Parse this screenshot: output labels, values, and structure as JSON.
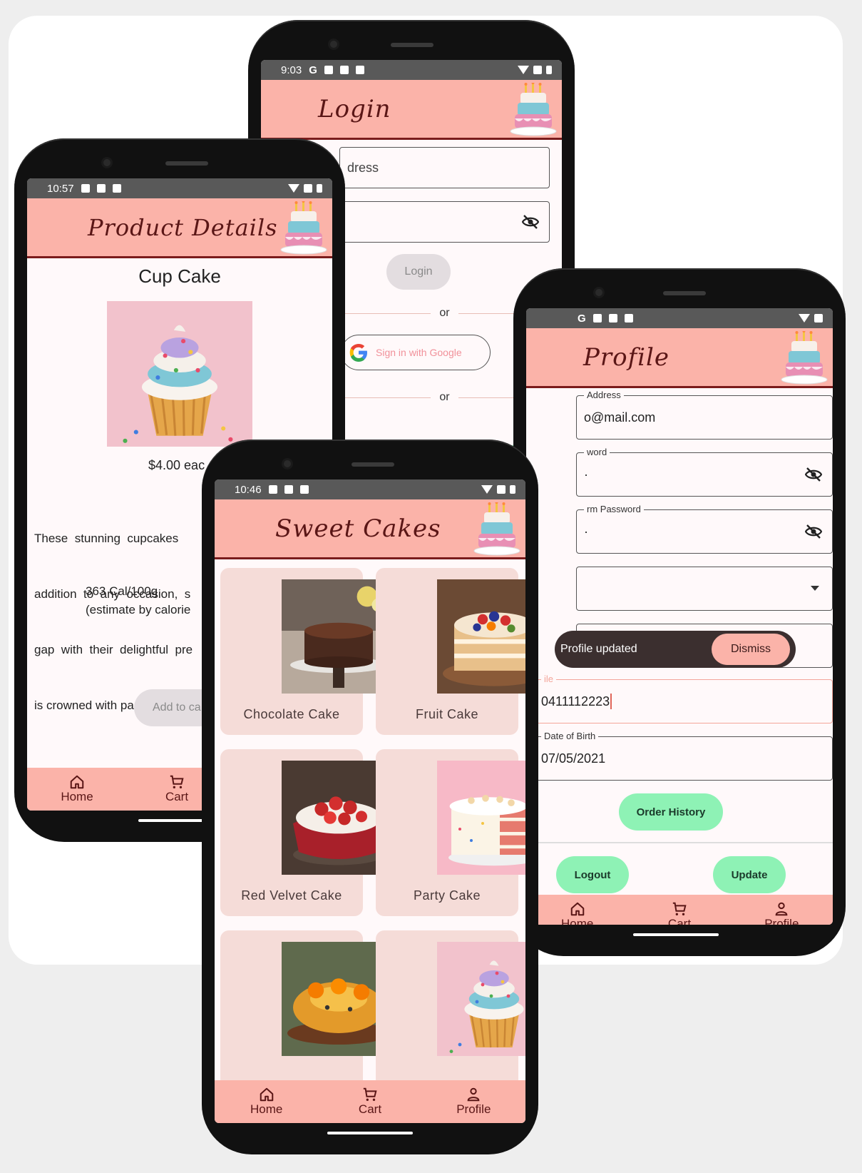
{
  "login": {
    "status_time": "9:03",
    "status_letter": "G",
    "title": "Login",
    "email_text": "dress",
    "login_button": "Login",
    "or_1": "or",
    "google_button": "Sign in with Google",
    "or_2": "or"
  },
  "product": {
    "status_time": "10:57",
    "title": "Product Details",
    "name": "Cup Cake",
    "price": "$4.00 eac",
    "description_lines": [
      "These  stunning  cupcakes",
      "addition  to  any  occasion,  s",
      "gap  with  their  delightful  pre",
      "is crowned with pastel frosti"
    ],
    "calories_line_1": "363 Cal/100g",
    "calories_line_2": "(estimate by calorie",
    "add_to_cart": "Add to ca",
    "nav": {
      "home": "Home",
      "cart": "Cart"
    }
  },
  "profile": {
    "title": "Profile",
    "email_label": "Address",
    "email_value": "o@mail.com",
    "password_label": "word",
    "password_value": "·",
    "confirm_label": "rm Password",
    "confirm_value": "·",
    "snackbar_text": "Profile updated",
    "snackbar_action": "Dismiss",
    "mobile_label": "ile",
    "mobile_value": "0411112223",
    "dob_label": "Date of Birth",
    "dob_value": "07/05/2021",
    "order_history": "Order History",
    "logout": "Logout",
    "update": "Update",
    "nav": {
      "home": "Home",
      "cart": "Cart",
      "profile": "Profile"
    }
  },
  "sweet": {
    "status_time": "10:46",
    "title": "Sweet Cakes",
    "cards": [
      {
        "label": "Chocolate Cake"
      },
      {
        "label": "Fruit Cake"
      },
      {
        "label": "Red Velvet Cake"
      },
      {
        "label": "Party Cake"
      },
      {
        "label": ""
      },
      {
        "label": ""
      }
    ],
    "nav": {
      "home": "Home",
      "cart": "Cart",
      "profile": "Profile"
    }
  },
  "colors": {
    "appbar": "#fbb3a9",
    "accent_green": "#8ef2b5",
    "dark_red": "#7a1c1c"
  }
}
